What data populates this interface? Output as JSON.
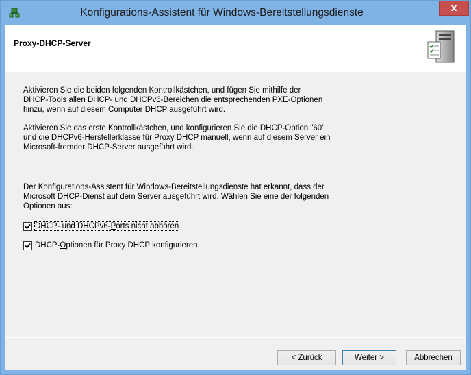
{
  "window": {
    "title": "Konfigurations-Assistent für Windows-Bereitstellungsdienste",
    "close_glyph": "x"
  },
  "header": {
    "title": "Proxy-DHCP-Server"
  },
  "body": {
    "para1_lines": [
      "Aktivieren Sie die beiden folgenden Kontrollkästchen, und fügen Sie mithilfe der",
      "DHCP-Tools allen DHCP- und DHCPv6-Bereichen die entsprechenden PXE-Optionen",
      "hinzu, wenn auf diesem Computer DHCP ausgeführt wird."
    ],
    "para2_lines": [
      "Aktivieren Sie das erste Kontrollkästchen, und konfigurieren Sie die DHCP-Option \"60\"",
      "und die DHCPv6-Herstellerklasse für Proxy DHCP manuell, wenn auf diesem Server ein",
      "Microsoft-fremder DHCP-Server ausgeführt wird."
    ],
    "para3_lines": [
      "Der Konfigurations-Assistent für Windows-Bereitstellungsdienste hat erkannt, dass der",
      "Microsoft DHCP-Dienst auf dem Server ausgeführt wird. Wählen Sie eine der folgenden",
      "Optionen aus:"
    ]
  },
  "checkboxes": [
    {
      "label_pre": "DHCP- und DHCPv6-",
      "label_accel": "P",
      "label_post": "orts nicht abhören",
      "checked": true
    },
    {
      "label_pre": "DHCP-",
      "label_accel": "O",
      "label_post": "ptionen für Proxy DHCP konfigurieren",
      "checked": true
    }
  ],
  "buttons": {
    "back": {
      "prefix": "< ",
      "accel": "Z",
      "rest": "urück"
    },
    "next": {
      "accel": "W",
      "rest": "eiter >"
    },
    "cancel": {
      "label": "Abbrechen"
    }
  },
  "icons": {
    "app": "network-setup-icon",
    "server": "server-checklist-icon"
  },
  "colors": {
    "titlebar": "#7fb2e5",
    "close": "#c7504f",
    "client": "#f0f0f0"
  }
}
